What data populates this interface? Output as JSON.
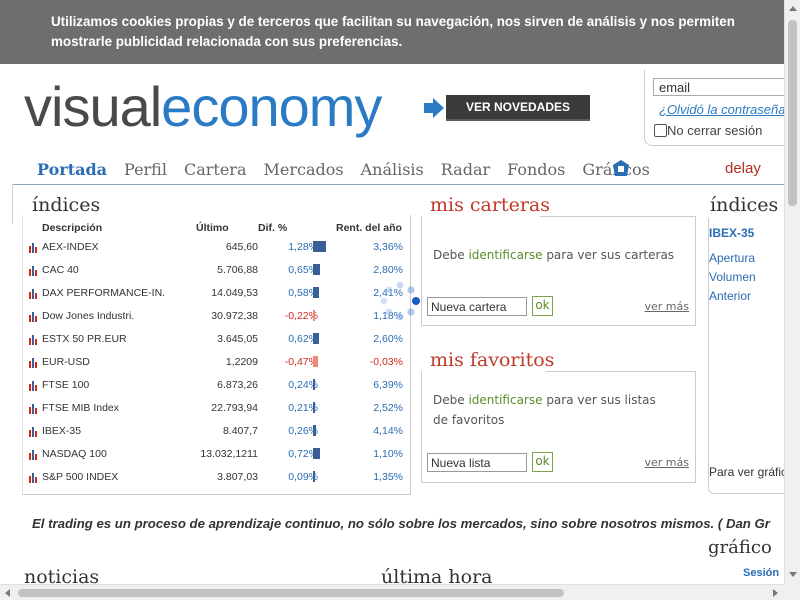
{
  "cookie_banner": {
    "text": "Utilizamos cookies propias y de terceros que facilitan su navegación, nos sirven de análisis y nos permiten mostrarle publicidad relacionada con sus preferencias."
  },
  "header": {
    "logo_part1": "visual",
    "logo_part2": "economy",
    "novedades_label": "VER NOVEDADES"
  },
  "login": {
    "email_value": "email",
    "forgot_label": "¿Olvidó la contraseña",
    "remember_label": "No cerrar sesión"
  },
  "nav": {
    "items": [
      "Portada",
      "Perfil",
      "Cartera",
      "Mercados",
      "Análisis",
      "Radar",
      "Fondos",
      "Gráficos"
    ],
    "active": "Portada",
    "delay_label": "delay"
  },
  "indices": {
    "title": "índices",
    "columns": [
      "Descripción",
      "Último",
      "Dif. %",
      "Rent. del año"
    ],
    "rows": [
      {
        "name": "AEX-INDEX",
        "last": "645,60",
        "dif": "1,28%",
        "dif_value": 1.28,
        "rent": "3,36%"
      },
      {
        "name": "CAC 40",
        "last": "5.706,88",
        "dif": "0,65%",
        "dif_value": 0.65,
        "rent": "2,80%"
      },
      {
        "name": "DAX PERFORMANCE-IN.",
        "last": "14.049,53",
        "dif": "0,58%",
        "dif_value": 0.58,
        "rent": "2,41%"
      },
      {
        "name": "Dow Jones Industri.",
        "last": "30.972,38",
        "dif": "-0,22%",
        "dif_value": -0.22,
        "rent": "1,18%"
      },
      {
        "name": "ESTX 50 PR.EUR",
        "last": "3.645,05",
        "dif": "0,62%",
        "dif_value": 0.62,
        "rent": "2,60%"
      },
      {
        "name": "EUR-USD",
        "last": "1,2209",
        "dif": "-0,47%",
        "dif_value": -0.47,
        "rent": "-0,03%"
      },
      {
        "name": "FTSE 100",
        "last": "6.873,26",
        "dif": "0,24%",
        "dif_value": 0.24,
        "rent": "6,39%"
      },
      {
        "name": "FTSE MIB Index",
        "last": "22.793,94",
        "dif": "0,21%",
        "dif_value": 0.21,
        "rent": "2,52%"
      },
      {
        "name": "IBEX-35",
        "last": "8.407,7",
        "dif": "0,26%",
        "dif_value": 0.26,
        "rent": "4,14%"
      },
      {
        "name": "NASDAQ 100",
        "last": "13.032,1211",
        "dif": "0,72%",
        "dif_value": 0.72,
        "rent": "1,10%"
      },
      {
        "name": "S&P 500 INDEX",
        "last": "3.807,03",
        "dif": "0,09%",
        "dif_value": 0.09,
        "rent": "1,35%"
      }
    ]
  },
  "carteras": {
    "title": "mis carteras",
    "msg_prefix": "Debe ",
    "msg_link": "identificarse",
    "msg_suffix": " para ver sus carteras",
    "input_value": "Nueva cartera",
    "ok_label": "ok",
    "more_label": "ver más"
  },
  "favoritos": {
    "title": "mis favoritos",
    "msg_prefix": "Debe ",
    "msg_link": "identificarse",
    "msg_suffix": " para ver sus listas de favoritos",
    "input_value": "Nueva lista",
    "ok_label": "ok",
    "more_label": "ver más"
  },
  "right_col": {
    "title": "índices",
    "index_name": "IBEX-35",
    "links": [
      "Apertura",
      "Volumen",
      "Anterior"
    ],
    "para": "Para ver gráfico"
  },
  "quote": "El trading es un proceso de aprendizaje continuo, no sólo sobre los mercados, sino sobre nosotros mismos. ( Dan Gr",
  "grafico_title": "gráfico",
  "sesion_label": "Sesión",
  "noticias_title": "noticias",
  "ultima_title": "última hora",
  "colors": {
    "accent": "#2a7bc4",
    "red": "#c0392b",
    "positive": "#2a6db4",
    "negative": "#d4281c"
  }
}
